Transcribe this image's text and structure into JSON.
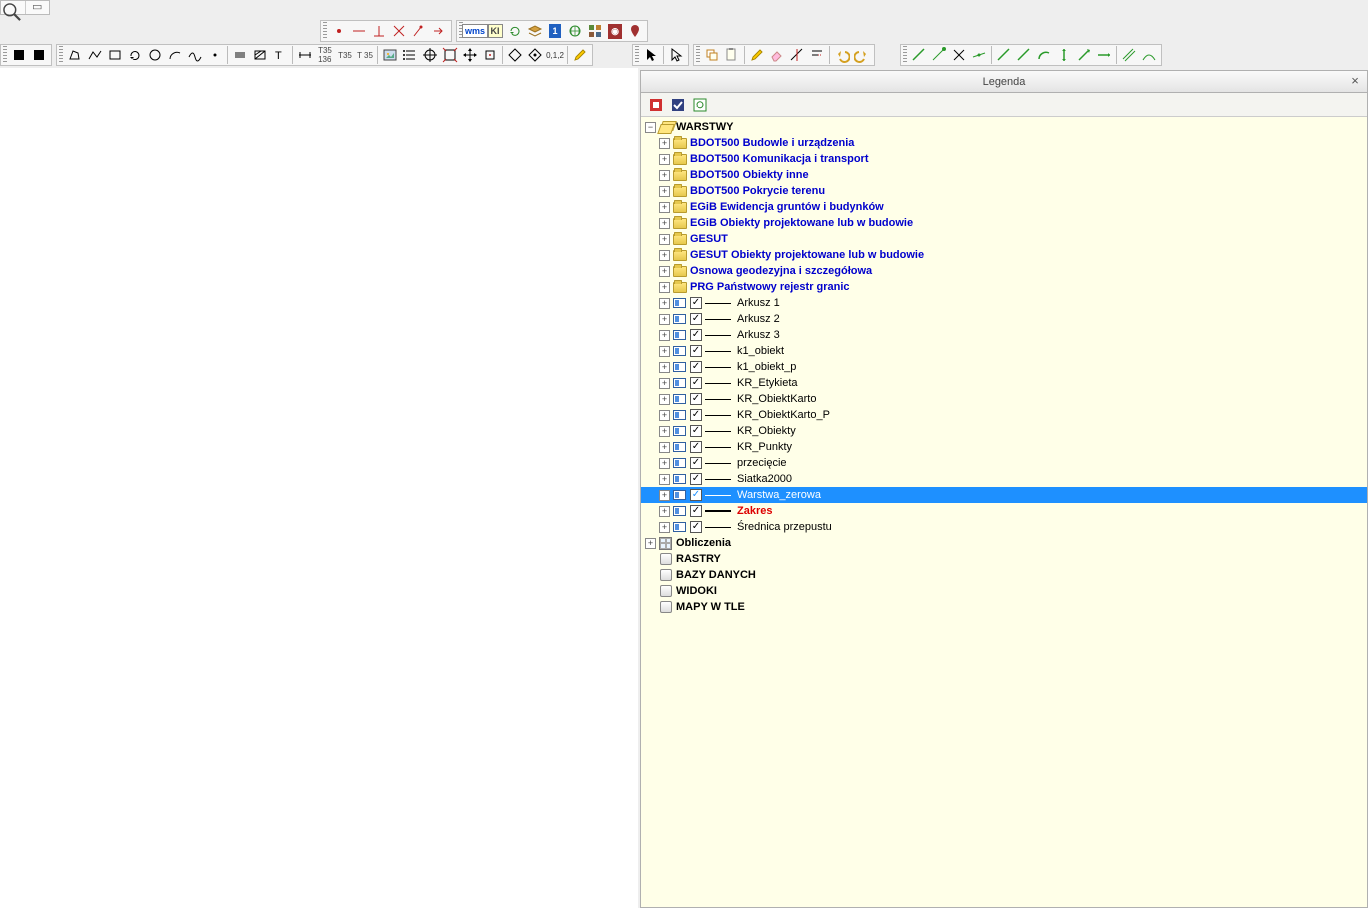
{
  "panel": {
    "title": "Legenda",
    "close": "×"
  },
  "tree": {
    "root": "WARSTWY",
    "folders": [
      "BDOT500 Budowle i urządzenia",
      "BDOT500 Komunikacja i transport",
      "BDOT500 Obiekty inne",
      "BDOT500 Pokrycie terenu",
      "EGiB Ewidencja gruntów i budynków",
      "EGiB Obiekty projektowane lub w budowie",
      "GESUT",
      "GESUT Obiekty projektowane lub w budowie",
      "Osnowa geodezyjna i szczegółowa",
      "PRG Państwowy rejestr granic"
    ],
    "layers": [
      {
        "label": "Arkusz 1",
        "checked": true,
        "thick": false
      },
      {
        "label": "Arkusz 2",
        "checked": true,
        "thick": false
      },
      {
        "label": "Arkusz 3",
        "checked": true,
        "thick": false
      },
      {
        "label": "k1_obiekt",
        "checked": true,
        "thick": false
      },
      {
        "label": "k1_obiekt_p",
        "checked": true,
        "thick": false
      },
      {
        "label": "KR_Etykieta",
        "checked": true,
        "thick": false
      },
      {
        "label": "KR_ObiektKarto",
        "checked": true,
        "thick": false
      },
      {
        "label": "KR_ObiektKarto_P",
        "checked": true,
        "thick": false
      },
      {
        "label": "KR_Obiekty",
        "checked": true,
        "thick": false
      },
      {
        "label": "KR_Punkty",
        "checked": true,
        "thick": false
      },
      {
        "label": "przecięcie",
        "checked": true,
        "thick": false
      },
      {
        "label": "Siatka2000",
        "checked": true,
        "thick": false
      },
      {
        "label": "Warstwa_zerowa",
        "checked": true,
        "thick": false,
        "selected": true
      },
      {
        "label": "Zakres",
        "checked": true,
        "thick": true,
        "red": true
      },
      {
        "label": "Średnica przepustu",
        "checked": true,
        "thick": false
      }
    ],
    "bottom": [
      "Obliczenia",
      "RASTRY",
      "BAZY DANYCH",
      "WIDOKI",
      "MAPY W TLE"
    ]
  },
  "toolbar1_labels": {
    "wms": "wms",
    "ki": "KI",
    "one": "1"
  },
  "topleft": {
    "a": "Q",
    "b": "▭"
  }
}
